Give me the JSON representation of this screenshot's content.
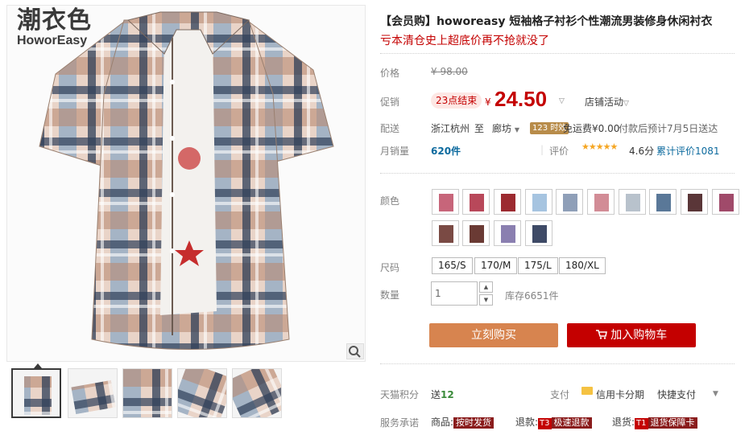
{
  "logo": {
    "cn": "潮衣色",
    "en": "HoworEasy"
  },
  "product": {
    "title": "【会员购】howoreasy 短袖格子衬衫个性潮流男装修身休闲衬衣",
    "subtitle": "亏本清仓史上超底价再不抢就没了"
  },
  "price": {
    "label": "价格",
    "original": "¥ 98.00"
  },
  "promo": {
    "label": "促销",
    "badge": "23点结束",
    "currency": "¥",
    "value": "24.50",
    "store_activity": "店铺活动"
  },
  "delivery": {
    "label": "配送",
    "from": "浙江杭州",
    "to_word": "至",
    "to": "廊坊",
    "tag": "123 时效",
    "fee": "免运费¥0.00",
    "estimate": "付款后预计7月5日送达"
  },
  "sales": {
    "label": "月销量",
    "count": "620件",
    "rating_label": "评价",
    "stars": "★★★★★",
    "score": "4.6分",
    "reviews": "累计评价1081"
  },
  "color": {
    "label": "颜色"
  },
  "size": {
    "label": "尺码",
    "options": [
      "165/S",
      "170/M",
      "175/L",
      "180/XL"
    ]
  },
  "quantity": {
    "label": "数量",
    "value": "1",
    "stock": "库存6651件"
  },
  "buttons": {
    "buy_now": "立刻购买",
    "add_cart": "加入购物车"
  },
  "points": {
    "label": "天猫积分",
    "value_prefix": "送",
    "value": "12",
    "pay_label": "支付",
    "card": "信用卡分期",
    "quick": "快捷支付"
  },
  "service": {
    "label": "服务承诺",
    "goods": "商品:",
    "goods_tag": "按时发货",
    "refund": "退款:",
    "refund_t": "T3",
    "refund_tag": "极速退款",
    "return": "退货:",
    "return_t": "T1",
    "return_tag": "退货保障卡"
  },
  "colors": {
    "accent": "#c40000",
    "buy": "#d7844f",
    "time_tag": "#b88c4a",
    "star": "#f5a623"
  }
}
